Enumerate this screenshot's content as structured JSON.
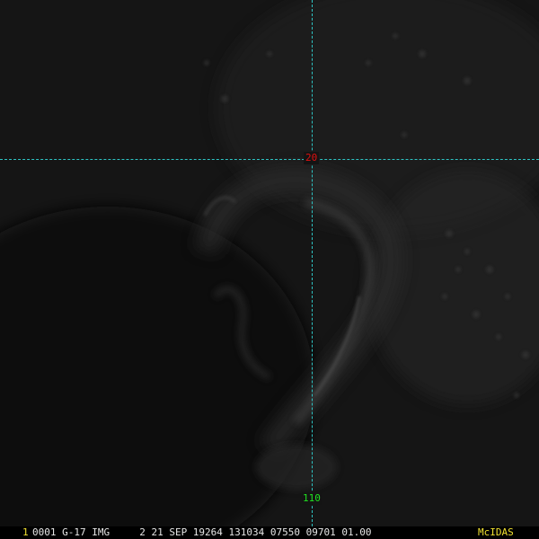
{
  "viewer": {
    "colors": {
      "background": "#141414",
      "grid_line": "#2ec4c4",
      "latitude_label": "#e01010",
      "longitude_label": "#20e020",
      "status_text": "#e6e6e6",
      "frame_number": "#f0e030",
      "brand": "#f0e030"
    },
    "grid": {
      "latitude_label": "20",
      "longitude_label": "110"
    }
  },
  "status_bar": {
    "frame_number": "1",
    "text": "0001 G-17 IMG     2 21 SEP 19264 131034 07550 09701 01.00",
    "brand": "McIDAS"
  }
}
